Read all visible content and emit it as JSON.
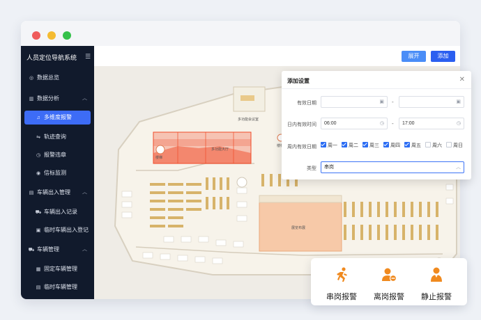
{
  "sidebar": {
    "title": "人员定位导航系统",
    "items": [
      {
        "label": "数据总览",
        "icon": "dashboard-icon"
      },
      {
        "label": "数据分析",
        "icon": "analytics-icon"
      },
      {
        "label": "多维度报警",
        "icon": "bell-icon"
      },
      {
        "label": "轨迹查询",
        "icon": "track-icon"
      },
      {
        "label": "报警违章",
        "icon": "alarm-icon"
      },
      {
        "label": "信标监测",
        "icon": "beacon-icon"
      },
      {
        "label": "车辆出入管理",
        "icon": "car-icon"
      },
      {
        "label": "车辆出入记录",
        "icon": "record-icon"
      },
      {
        "label": "临时车辆出入登记",
        "icon": "register-icon"
      },
      {
        "label": "车辆管理",
        "icon": "vehicle-icon"
      },
      {
        "label": "固定车辆管理",
        "icon": "fixed-car-icon"
      },
      {
        "label": "临时车辆管理",
        "icon": "temp-car-icon"
      }
    ]
  },
  "toolbar": {
    "expand_label": "展开",
    "add_label": "添加"
  },
  "map": {
    "labels": {
      "room_a": "多功能会议室",
      "room_b": "多功能大厅",
      "stairs_left": "楼梯",
      "stairs_right": "楼梯",
      "exhibit": "展览布展",
      "room_c": "内"
    }
  },
  "dialog": {
    "title": "添加设置",
    "valid_date_label": "有效日期",
    "daily_time_label": "日内有效时间",
    "start_time": "06:00",
    "end_time": "17:00",
    "weekly_label": "周内有效日期",
    "weekdays": [
      {
        "label": "周一",
        "checked": true
      },
      {
        "label": "周二",
        "checked": true
      },
      {
        "label": "周三",
        "checked": true
      },
      {
        "label": "周四",
        "checked": true
      },
      {
        "label": "周五",
        "checked": true
      },
      {
        "label": "周六",
        "checked": false
      },
      {
        "label": "周日",
        "checked": false
      }
    ],
    "type_label": "类型",
    "type_value": "串岗",
    "range_dash": "-"
  },
  "alarms": [
    {
      "label": "串岗报警",
      "icon": "running-person-icon"
    },
    {
      "label": "离岗报警",
      "icon": "person-leave-icon"
    },
    {
      "label": "静止报警",
      "icon": "person-still-icon"
    }
  ],
  "colors": {
    "accent": "#3d6cf6",
    "sidebar_bg": "#111a2c",
    "alarm_orange": "#f08a1f",
    "zone_red": "#f04b2a"
  }
}
